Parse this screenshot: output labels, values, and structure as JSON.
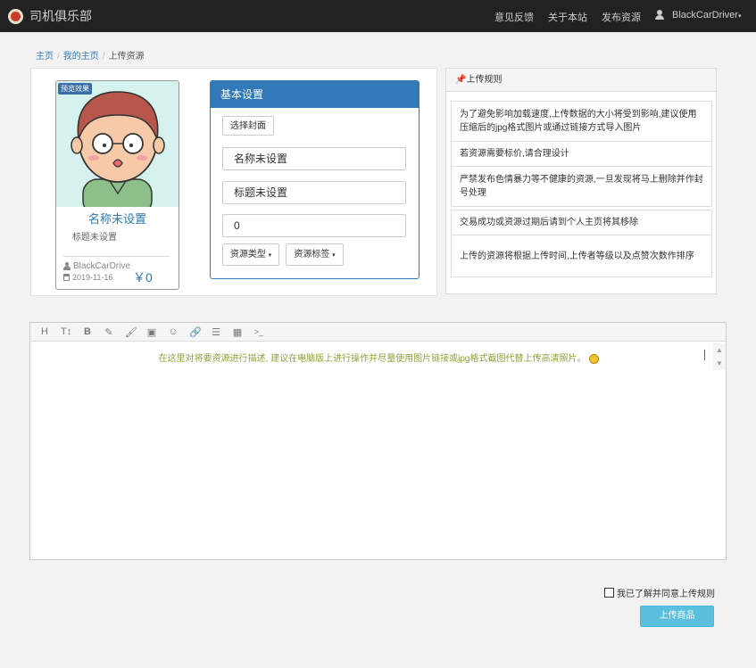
{
  "nav": {
    "brand": "司机俱乐部",
    "links": [
      "意见反馈",
      "关于本站",
      "发布资源"
    ],
    "user": "BlackCarDriver"
  },
  "breadcrumb": [
    "主页",
    "我的主页",
    "上传资源"
  ],
  "preview": {
    "badge": "预览效果",
    "name": "名称未设置",
    "subtitle": "标题未设置",
    "author": "BlackCarDrive",
    "date": "2019-11-16",
    "price": "￥0"
  },
  "settings": {
    "title": "基本设置",
    "cover_button": "选择封面",
    "name_value": "名称未设置",
    "title_value": "标题未设置",
    "price_value": "0",
    "type_button": "资源类型",
    "tag_button": "资源标签"
  },
  "rules": {
    "title": "上传规则",
    "items": [
      "为了避免影响加载速度,上传数据的大小将受到影响,建议使用压缩后的jpg格式图片或通过链接方式导入图片",
      "若资源需要标价,请合理设计",
      "严禁发布色情暴力等不健康的资源,一旦发现将马上删除并作封号处理",
      "交易成功或资源过期后请到个人主页将其移除",
      "上传的资源将根据上传时间,上传者等级以及点赞次数作排序"
    ]
  },
  "editor": {
    "toolbar": [
      "H",
      "T↕",
      "B",
      "✎",
      "🖌",
      "▣",
      "☺",
      "🔗",
      "☰",
      "▦",
      ">_"
    ],
    "placeholder": "在这里对将要资源进行描述, 建议在电脑版上进行操作并尽量使用图片链接或jpg格式截图代替上传高清照片。"
  },
  "agree_label": "我已了解并同意上传规则",
  "submit_label": "上传商品",
  "colors": {
    "navbar": "#222222",
    "primary": "#3279b7",
    "submit": "#5bc0de",
    "placeholder": "#8aa538"
  }
}
